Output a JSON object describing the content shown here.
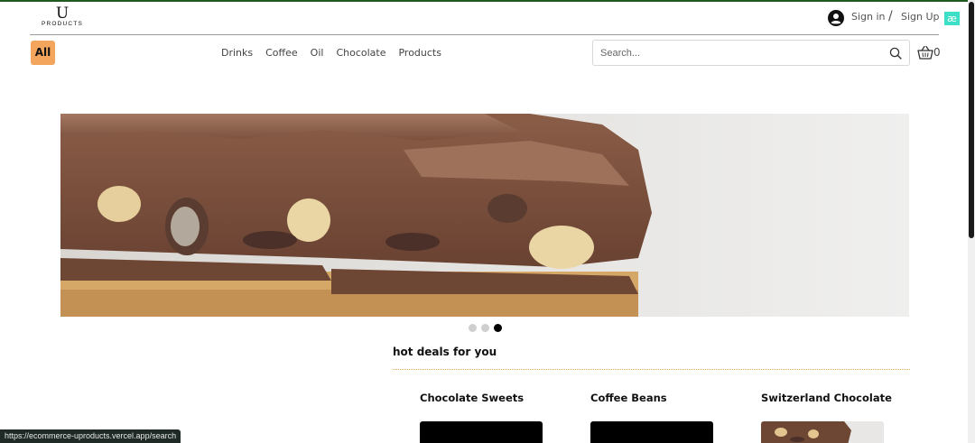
{
  "header": {
    "logo_letter": "U",
    "logo_word": "PRODUCTS",
    "signin_label": "Sign in",
    "separator": "/",
    "signup_label": "Sign Up",
    "language_badge": "æ"
  },
  "nav": {
    "all_label": "All",
    "links": [
      "Drinks",
      "Coffee",
      "Oil",
      "Chocolate",
      "Products"
    ]
  },
  "search": {
    "placeholder": "Search...",
    "value": ""
  },
  "cart": {
    "count": "0"
  },
  "carousel": {
    "slide_count": 3,
    "active_index": 2
  },
  "hot_deals": {
    "title": "hot deals for you",
    "cards": [
      {
        "title": "Chocolate Sweets"
      },
      {
        "title": "Coffee Beans"
      },
      {
        "title": "Switzerland Chocolate"
      }
    ]
  },
  "status_bar": {
    "url": "https://ecommerce-uproducts.vercel.app/search"
  },
  "colors": {
    "accent": "#f3a45d",
    "language_badge": "#3ddfc6",
    "deals_rule": "#e2a95a",
    "top_line": "#1f5a1f"
  }
}
